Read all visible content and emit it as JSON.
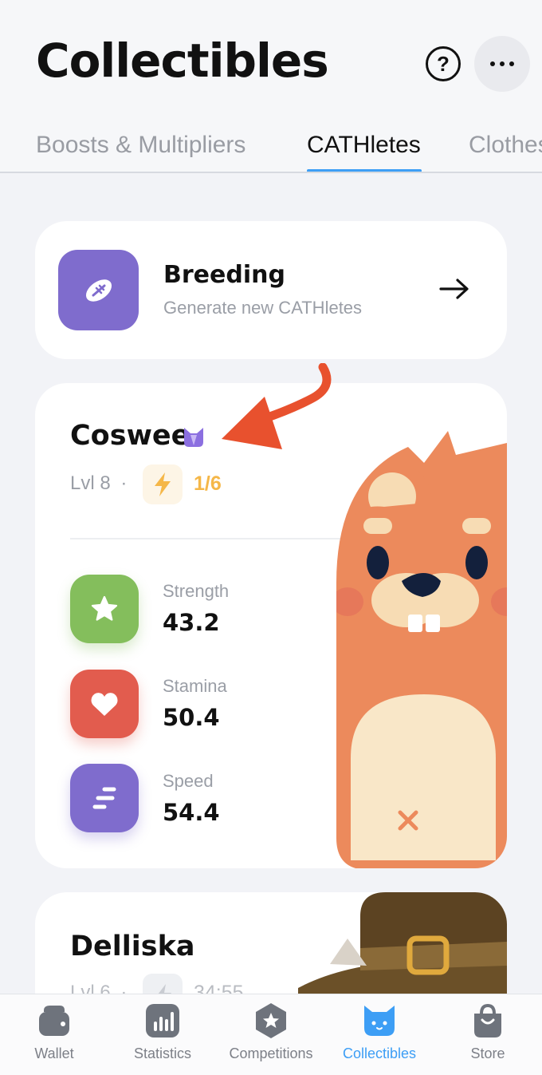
{
  "header": {
    "title": "Collectibles",
    "help_label": "?"
  },
  "tabs": [
    {
      "label": "Boosts & Multipliers",
      "active": false
    },
    {
      "label": "CATHletes",
      "active": true
    },
    {
      "label": "Clothes",
      "active": false
    }
  ],
  "breeding": {
    "title": "Breeding",
    "subtitle": "Generate new CATHletes"
  },
  "athletes": [
    {
      "name": "Coswee",
      "level": "Lvl 8",
      "separator": "·",
      "energy": "1/6",
      "stats": [
        {
          "label": "Strength",
          "value": "43.2",
          "color": "#84be5c",
          "icon": "star-icon"
        },
        {
          "label": "Stamina",
          "value": "50.4",
          "color": "#e25c4e",
          "icon": "heart-icon"
        },
        {
          "label": "Speed",
          "value": "54.4",
          "color": "#7f6ccd",
          "icon": "speed-lines-icon"
        }
      ]
    },
    {
      "name": "Delliska",
      "level": "Lvl 6",
      "separator": "·",
      "timer": "34:55"
    }
  ],
  "nav": [
    {
      "label": "Wallet",
      "icon": "wallet-icon",
      "active": false
    },
    {
      "label": "Statistics",
      "icon": "statistics-icon",
      "active": false
    },
    {
      "label": "Competitions",
      "icon": "competitions-icon",
      "active": false
    },
    {
      "label": "Collectibles",
      "icon": "cat-icon",
      "active": true
    },
    {
      "label": "Store",
      "icon": "bag-icon",
      "active": false
    }
  ],
  "colors": {
    "accent": "#3d9ef5",
    "purple": "#7f6ccd",
    "energy": "#f5b748",
    "annotation_arrow": "#e8512e"
  }
}
